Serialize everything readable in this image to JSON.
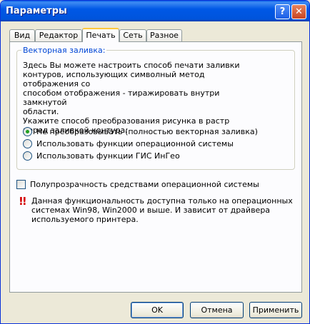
{
  "window": {
    "title": "Параметры"
  },
  "titlebar": {
    "help_label": "?",
    "close_label": "✕"
  },
  "tabs": [
    {
      "label": "Вид"
    },
    {
      "label": "Редактор"
    },
    {
      "label": "Печать",
      "active": true
    },
    {
      "label": "Сеть"
    },
    {
      "label": "Разное"
    }
  ],
  "vector_fill": {
    "title": "Векторная заливка:",
    "description": "Здесь Вы можете настроить способ печати заливки\nконтуров, использующих символный метод отображения со\nспособом отображения - тиражировать внутри замкнутой\nобласти.\nУкажите способ преобразования рисунка в растр\nперед заливкой контура:",
    "options": [
      {
        "label": "Не преобразовывать (полностью векторная заливка)",
        "selected": true
      },
      {
        "label": "Использовать функции операционной системы",
        "selected": false
      },
      {
        "label": "Использовать функции ГИС ИнГео",
        "selected": false
      }
    ]
  },
  "transparency": {
    "label": "Полупрозрачность средствами операционной системы",
    "checked": false
  },
  "warning": {
    "icon": "exclamation-icon",
    "text": "Данная функциональность доступна только на операционных системах Win98, Win2000 и выше. И зависит от драйвера используемого принтера."
  },
  "buttons": {
    "ok": "OK",
    "cancel": "Отмена",
    "apply": "Применить"
  },
  "colors": {
    "titlebar": "#0054e3",
    "group_title": "#0046d5",
    "radio_selected": "#21a121",
    "warning": "#d40000"
  }
}
